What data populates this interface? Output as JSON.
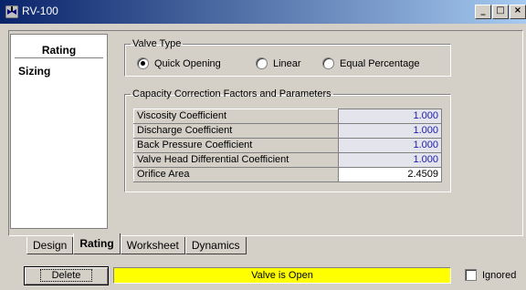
{
  "window": {
    "title": "RV-100",
    "min_label": "_",
    "max_label": "□",
    "close_label": "×"
  },
  "left_panel": {
    "header": "Rating",
    "items": [
      {
        "label": "Sizing"
      }
    ]
  },
  "valve_type": {
    "legend": "Valve Type",
    "options": [
      {
        "label": "Quick Opening",
        "selected": true
      },
      {
        "label": "Linear",
        "selected": false
      },
      {
        "label": "Equal Percentage",
        "selected": false
      }
    ]
  },
  "capacity": {
    "legend": "Capacity Correction Factors and Parameters",
    "rows": [
      {
        "label": "Viscosity Coefficient",
        "value": "1.000"
      },
      {
        "label": "Discharge Coefficient",
        "value": "1.000"
      },
      {
        "label": "Back Pressure Coefficient",
        "value": "1.000"
      },
      {
        "label": "Valve Head Differential Coefficient",
        "value": "1.000"
      },
      {
        "label": "Orifice Area",
        "value": "2.4509"
      }
    ]
  },
  "tabs": [
    {
      "label": "Design",
      "active": false
    },
    {
      "label": "Rating",
      "active": true
    },
    {
      "label": "Worksheet",
      "active": false
    },
    {
      "label": "Dynamics",
      "active": false
    }
  ],
  "footer": {
    "delete_label": "Delete",
    "status_text": "Valve is Open",
    "status_color": "#ffff00",
    "ignored_label": "Ignored",
    "ignored_checked": false
  }
}
